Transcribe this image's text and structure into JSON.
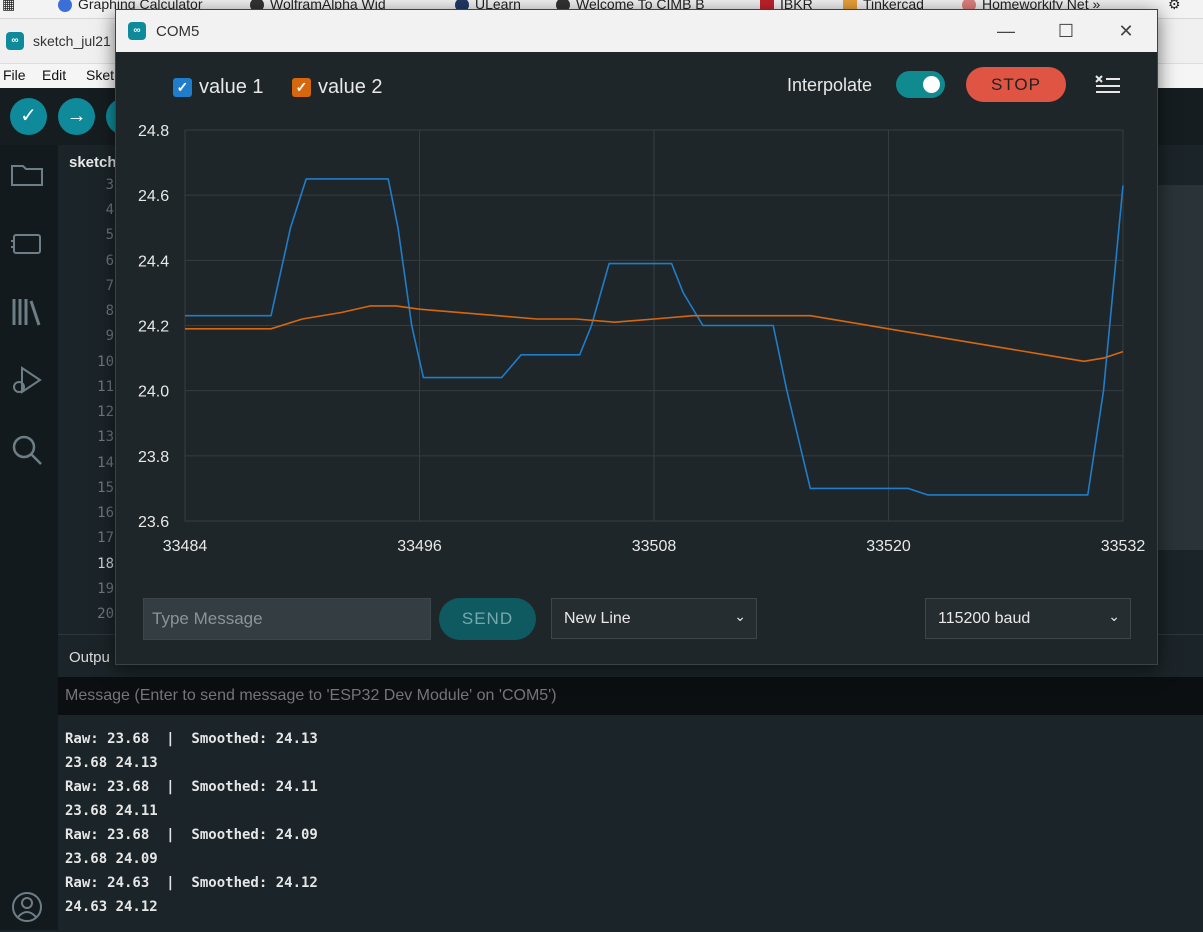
{
  "bookmarks": [
    {
      "label": "Graphing Calculator"
    },
    {
      "label": "WolframAlpha Wid"
    },
    {
      "label": "ULearn"
    },
    {
      "label": "Welcome To CIMB B"
    },
    {
      "label": "IBKR"
    },
    {
      "label": "Tinkercad"
    },
    {
      "label": "Homeworkify Net »"
    }
  ],
  "ide": {
    "title": "sketch_jul21",
    "menu": [
      "File",
      "Edit",
      "Sket"
    ],
    "tab_label": "sketch",
    "line_numbers": [
      "3",
      "4",
      "5",
      "6",
      "7",
      "8",
      "9",
      "10",
      "11",
      "12",
      "13",
      "14",
      "15",
      "16",
      "17",
      "18",
      "19",
      "20"
    ],
    "output_label": "Outpu",
    "message_placeholder": "Message (Enter to send message to 'ESP32 Dev Module' on 'COM5')",
    "output_lines": [
      "Raw: 23.68  |  Smoothed: 24.13",
      "23.68 24.13",
      "Raw: 23.68  |  Smoothed: 24.11",
      "23.68 24.11",
      "Raw: 23.68  |  Smoothed: 24.09",
      "23.68 24.09",
      "Raw: 24.63  |  Smoothed: 24.12",
      "24.63 24.12"
    ]
  },
  "plotter": {
    "title": "COM5",
    "legend": [
      {
        "label": "value 1",
        "color": "#1f7dc9",
        "checked": true
      },
      {
        "label": "value 2",
        "color": "#d6670f",
        "checked": true
      }
    ],
    "interpolate_label": "Interpolate",
    "interpolate_on": true,
    "stop_label": "STOP",
    "message_placeholder": "Type Message",
    "send_label": "SEND",
    "line_ending": "New Line",
    "baud": "115200 baud"
  },
  "chart_data": {
    "type": "line",
    "xlim": [
      33484,
      33532
    ],
    "ylim": [
      23.6,
      24.8
    ],
    "x_ticks": [
      "33484",
      "33496",
      "33508",
      "33520",
      "33532"
    ],
    "y_ticks": [
      "24.8",
      "24.6",
      "24.4",
      "24.2",
      "24.0",
      "23.8",
      "23.6"
    ],
    "grid": true,
    "series": [
      {
        "name": "value 1",
        "color": "#1f7dc9",
        "points": [
          [
            33484,
            24.23
          ],
          [
            33488.4,
            24.23
          ],
          [
            33489.4,
            24.5
          ],
          [
            33490.2,
            24.65
          ],
          [
            33494.4,
            24.65
          ],
          [
            33494.9,
            24.5
          ],
          [
            33495.6,
            24.2
          ],
          [
            33496.2,
            24.04
          ],
          [
            33500.2,
            24.04
          ],
          [
            33501.2,
            24.11
          ],
          [
            33504.2,
            24.11
          ],
          [
            33504.8,
            24.2
          ],
          [
            33505.7,
            24.39
          ],
          [
            33508.9,
            24.39
          ],
          [
            33509.5,
            24.3
          ],
          [
            33510.5,
            24.2
          ],
          [
            33513.6,
            24.2
          ],
          [
            33514.1,
            24.2
          ],
          [
            33514.8,
            24.0
          ],
          [
            33516.0,
            23.7
          ],
          [
            33521.0,
            23.7
          ],
          [
            33522.0,
            23.68
          ],
          [
            33530.2,
            23.68
          ],
          [
            33531.0,
            24.0
          ],
          [
            33532,
            24.63
          ]
        ]
      },
      {
        "name": "value 2",
        "color": "#d6670f",
        "points": [
          [
            33484,
            24.19
          ],
          [
            33488.4,
            24.19
          ],
          [
            33490.0,
            24.22
          ],
          [
            33492.0,
            24.24
          ],
          [
            33493.5,
            24.26
          ],
          [
            33494.8,
            24.26
          ],
          [
            33496.0,
            24.25
          ],
          [
            33500.0,
            24.23
          ],
          [
            33502.0,
            24.22
          ],
          [
            33504.0,
            24.22
          ],
          [
            33506.0,
            24.21
          ],
          [
            33508.0,
            24.22
          ],
          [
            33510.0,
            24.23
          ],
          [
            33512.0,
            24.23
          ],
          [
            33514.0,
            24.23
          ],
          [
            33516.0,
            24.23
          ],
          [
            33518.0,
            24.21
          ],
          [
            33520.0,
            24.19
          ],
          [
            33522.0,
            24.17
          ],
          [
            33524.0,
            24.15
          ],
          [
            33526.0,
            24.13
          ],
          [
            33528.0,
            24.11
          ],
          [
            33530.0,
            24.09
          ],
          [
            33531.0,
            24.1
          ],
          [
            33532,
            24.12
          ]
        ]
      }
    ]
  }
}
